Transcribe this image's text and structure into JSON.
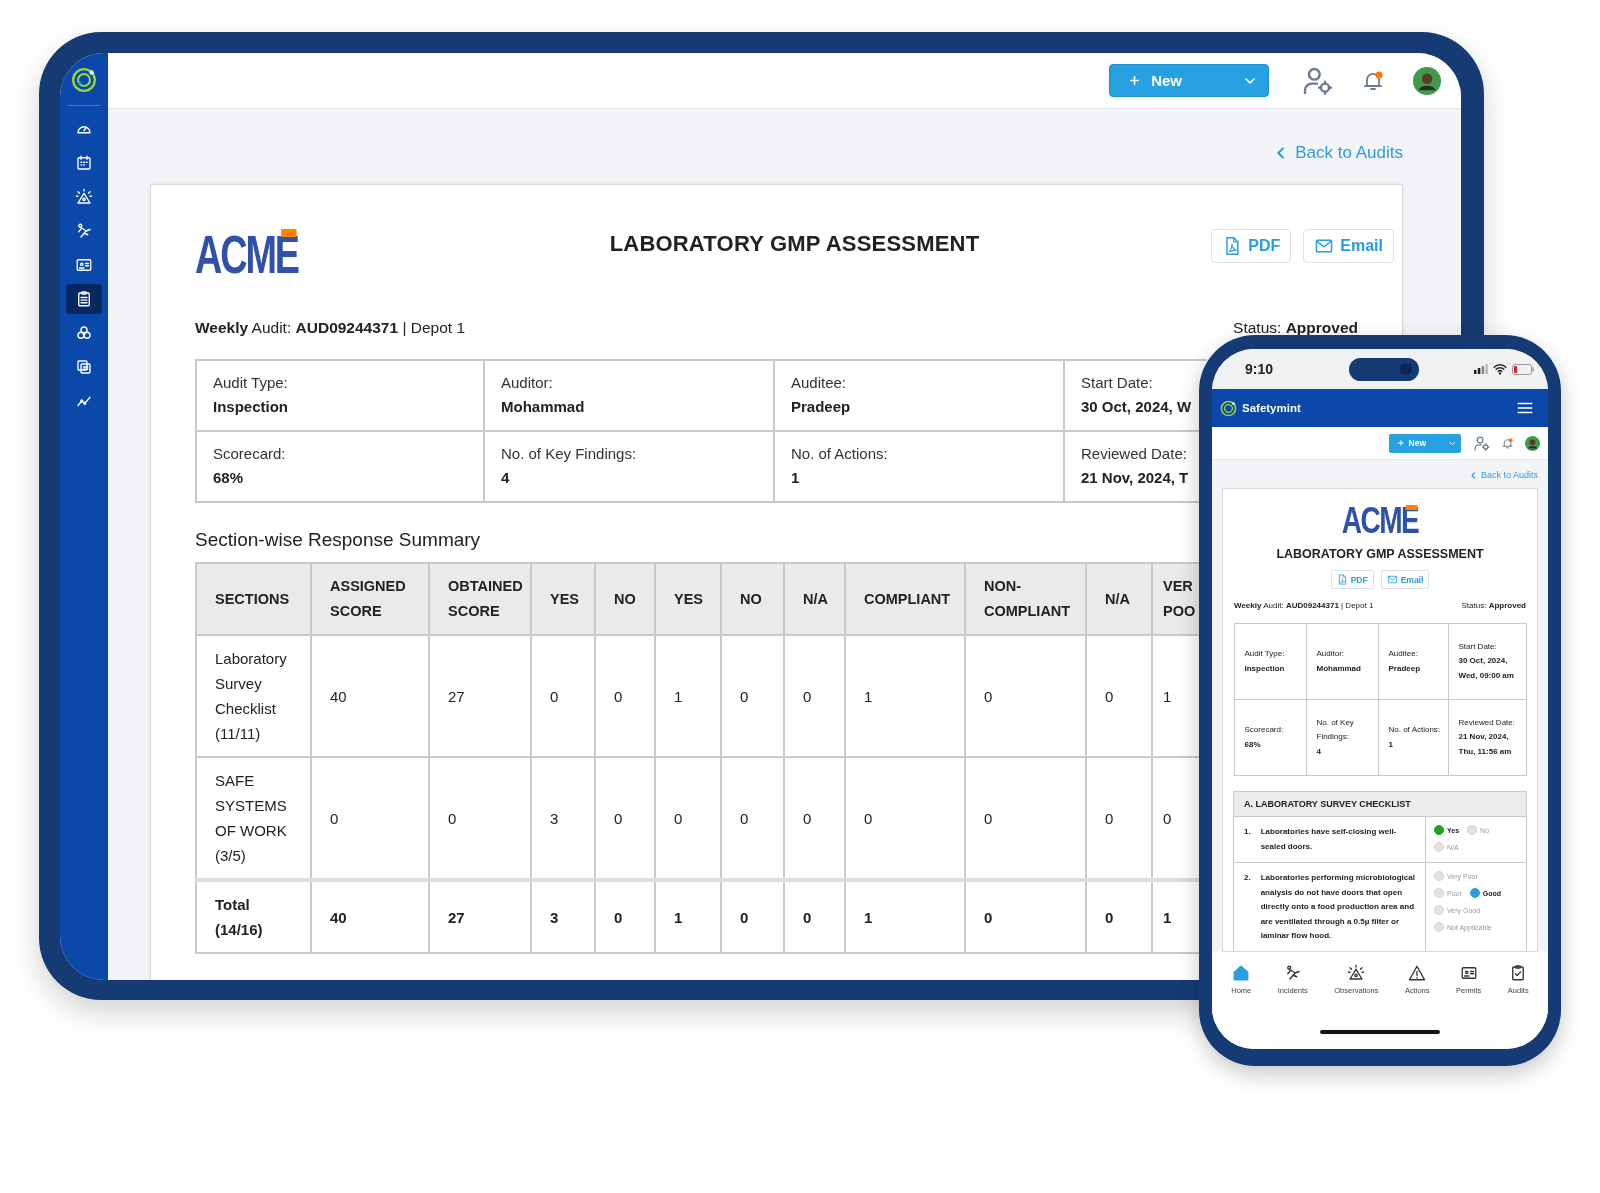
{
  "tablet": {
    "sidebar": [
      {
        "selected": false
      },
      {
        "selected": false
      },
      {
        "selected": false
      },
      {
        "selected": false
      },
      {
        "selected": false
      },
      {
        "selected": true
      },
      {
        "selected": false
      },
      {
        "selected": false
      },
      {
        "selected": false
      }
    ],
    "new_button": "New",
    "back_link": "Back to Audits",
    "report": {
      "logo": "ACME",
      "title": "LABORATORY GMP ASSESSMENT",
      "actions": [
        "PDF",
        "Email"
      ],
      "audit_line": "**Weekly** Audit: **AUD09244371** | Depot 1",
      "status": "Status: **Approved**",
      "details": [
        {
          "label": "Audit Type:",
          "value": "Inspection"
        },
        {
          "label": "Auditor:",
          "value": "Mohammad"
        },
        {
          "label": "Auditee:",
          "value": "Pradeep"
        },
        {
          "label": "Start Date:",
          "value": "30 Oct, 2024, W"
        },
        {
          "label": "Scorecard:",
          "value": "68%"
        },
        {
          "label": "No. of Key Findings:",
          "value": "4"
        },
        {
          "label": "No. of Actions:",
          "value": "1"
        },
        {
          "label": "Reviewed Date:",
          "value": "21 Nov, 2024, T"
        }
      ],
      "summary_title": "Section-wise Response Summary",
      "summary": {
        "columns": [
          "SECTIONS",
          "ASSIGNED SCORE",
          "OBTAINED SCORE",
          "YES",
          "NO",
          "YES",
          "NO",
          "N/A",
          "COMPLIANT",
          "NON-COMPLIANT",
          "N/A",
          "VER POO"
        ],
        "rows": [
          {
            "kind": "section",
            "cells": [
              "Laboratory Survey Checklist (11/11)",
              "40",
              "27",
              "0",
              "0",
              "1",
              "0",
              "0",
              "1",
              "0",
              "0",
              "1"
            ]
          },
          {
            "kind": "section",
            "cells": [
              "SAFE SYSTEMS OF WORK (3/5)",
              "0",
              "0",
              "3",
              "0",
              "0",
              "0",
              "0",
              "0",
              "0",
              "0",
              "0"
            ]
          },
          {
            "kind": "total",
            "cells": [
              "Total (14/16)",
              "40",
              "27",
              "3",
              "0",
              "1",
              "0",
              "0",
              "1",
              "0",
              "0",
              "1"
            ]
          }
        ]
      }
    }
  },
  "phone": {
    "time": "9:10",
    "brand": "Safetymint",
    "new_button": "New",
    "back_link": "Back to Audits",
    "report": {
      "logo": "ACME",
      "title": "LABORATORY GMP ASSESSMENT",
      "actions": [
        "PDF",
        "Email"
      ],
      "audit_line": "**Weekly** Audit: **AUD09244371** | Depot 1",
      "status": "Status: **Approved**",
      "details": [
        {
          "label": "Audit Type:",
          "value": "Inspection"
        },
        {
          "label": "Auditor:",
          "value": "Mohammad"
        },
        {
          "label": "Auditee:",
          "value": "Pradeep"
        },
        {
          "label": "Start Date:",
          "value": "30 Oct, 2024, Wed, 09:00 am"
        },
        {
          "label": "Scorecard:",
          "value": "68%"
        },
        {
          "label": "No. of Key Findings:",
          "value": "4"
        },
        {
          "label": "No. of Actions:",
          "value": "1"
        },
        {
          "label": "Reviewed Date:",
          "value": "21 Nov, 2024, Thu, 11:56 am"
        }
      ],
      "section": "A. LABORATORY SURVEY CHECKLIST",
      "questions": [
        {
          "number": "1.",
          "text": "Laboratories have self-closing well-sealed doors.",
          "options": [
            {
              "label": "Yes",
              "selected": true,
              "color": "#17a521"
            },
            {
              "label": "No",
              "selected": false
            },
            {
              "label": "N/A",
              "selected": false
            }
          ]
        },
        {
          "number": "2.",
          "text": "Laboratories performing microbiological analysis do not have doors that open directly onto a food production area and are ventilated through a 0.5µ filter or laminar flow hood.",
          "options": [
            {
              "label": "Very Poor",
              "selected": false
            },
            {
              "label": "Poor",
              "selected": false
            },
            {
              "label": "Good",
              "selected": true,
              "color": "#2a9de0"
            },
            {
              "label": "Very Good",
              "selected": false
            },
            {
              "label": "Not Applicable",
              "selected": false
            }
          ]
        }
      ]
    },
    "nav": [
      {
        "label": "Home",
        "selected": true
      },
      {
        "label": "Incidents",
        "selected": false
      },
      {
        "label": "Observations",
        "selected": false
      },
      {
        "label": "Actions",
        "selected": false
      },
      {
        "label": "Permits",
        "selected": false
      },
      {
        "label": "Audits",
        "selected": false
      }
    ]
  }
}
